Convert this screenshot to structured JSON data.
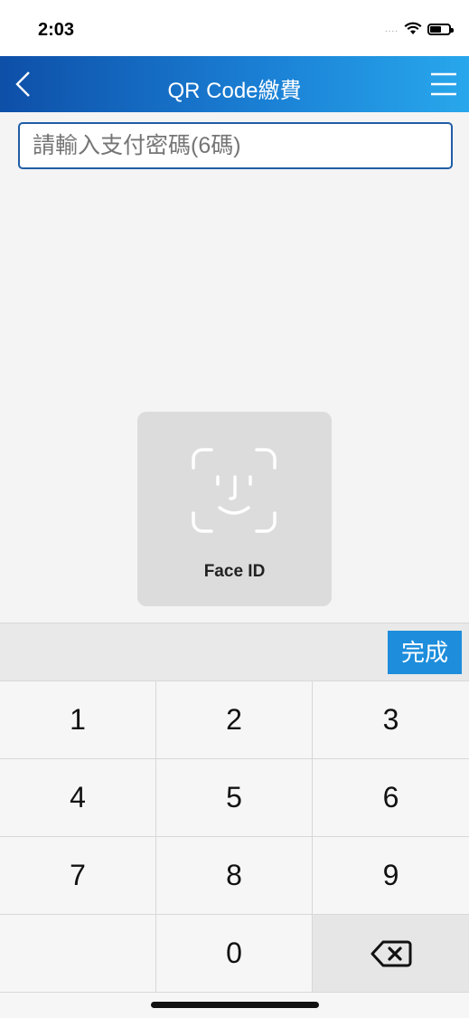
{
  "status": {
    "time": "2:03",
    "signal": "....",
    "wifi_icon": "wifi-icon",
    "battery_icon": "battery-icon"
  },
  "nav": {
    "title": "QR Code繳費",
    "back_icon": "chevron-left-icon",
    "menu_icon": "hamburger-menu-icon"
  },
  "password": {
    "placeholder": "請輸入支付密碼(6碼)",
    "value": ""
  },
  "faceid": {
    "label": "Face ID",
    "icon": "face-id-icon"
  },
  "keyboard": {
    "done_label": "完成",
    "keys": [
      "1",
      "2",
      "3",
      "4",
      "5",
      "6",
      "7",
      "8",
      "9",
      "",
      "0"
    ],
    "backspace_icon": "backspace-icon"
  },
  "colors": {
    "nav_start": "#0e4fa8",
    "nav_end": "#28a7ec",
    "accent": "#1d8ddc",
    "field_border": "#1f5da6"
  }
}
